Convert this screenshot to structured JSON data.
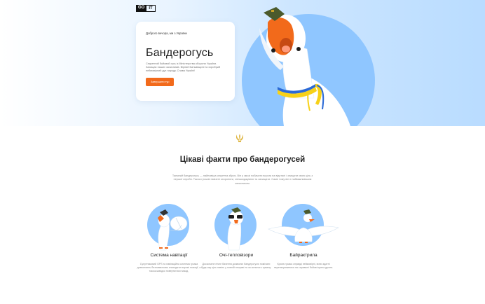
{
  "logo": {
    "part1": "GO",
    "part2": "IT"
  },
  "hero": {
    "greeting": "Доброго вечора, ми з України",
    "title": "Бандерогусь",
    "description": "Секретний бойовий гусь із Міністерства оборони України. Захищає наших захисників. Вірний Батьківщині та хоробрий неймовірний дух народу. Слава Україні!",
    "cta": "Завершити тур"
  },
  "facts": {
    "title": "Цікаві факти про бандерогусей",
    "intro": "Таємний бандерогусь — найновіша секретна зброя. Він у змозі побачити ворога на відстані і знищити свою ціль з першої спроби. Також гусьові навчені охороняти, знешкоджувати та захищати. Саме тому він є найважливішим захисником.",
    "items": [
      {
        "name": "Система навігації",
        "text": "Супутниковий GPS та навігаційна система гусака дозволяють безпомилково знаходити ворожі позиції, а також швидко повертатися назад."
      },
      {
        "name": "Очі-тепловізори",
        "text": "Досконале нічне бачення дозволяє бандерогусю помічати будь-яку ціль навіть у повній темряві та за сильного туману."
      },
      {
        "name": "Байрактрила",
        "text": "Крила гусака справді неймовірні, вони здатні перетворюватися на справжні бойові крила дрона."
      }
    ]
  },
  "colors": {
    "accent": "#f26a1b",
    "heroBlue": "#8fc6ff",
    "ribbonBlue": "#2a69d6",
    "ribbonYellow": "#f7d118"
  }
}
